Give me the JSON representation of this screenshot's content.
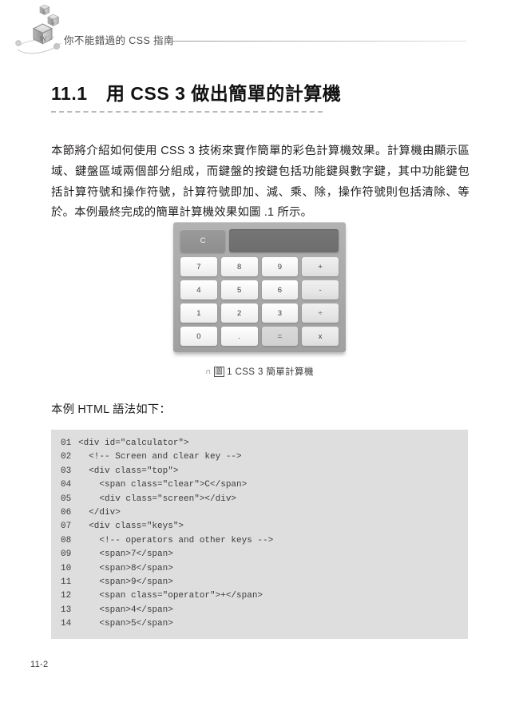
{
  "header": {
    "title": "你不能錯過的 CSS 指南",
    "logo_name": "cube-w-logo"
  },
  "section": {
    "number": "11.1",
    "heading": "11.1 用 CSS 3 做出簡單的計算機"
  },
  "paragraph": "本節將介紹如何使用 CSS 3 技術來實作簡單的彩色計算機效果。計算機由顯示區域、鍵盤區域兩個部分組成，而鍵盤的按鍵包括功能鍵與數字鍵，其中功能鍵包括計算符號和操作符號，計算符號即加、減、乘、除，操作符號則包括清除、等於。本例最終完成的簡單計算機效果如圖 .1 所示。",
  "figure": {
    "calculator": {
      "clear_label": "C",
      "screen_value": "",
      "keys": [
        {
          "label": "7",
          "type": "number"
        },
        {
          "label": "8",
          "type": "number"
        },
        {
          "label": "9",
          "type": "number"
        },
        {
          "label": "+",
          "type": "operator"
        },
        {
          "label": "4",
          "type": "number"
        },
        {
          "label": "5",
          "type": "number"
        },
        {
          "label": "6",
          "type": "number"
        },
        {
          "label": "-",
          "type": "operator"
        },
        {
          "label": "1",
          "type": "number"
        },
        {
          "label": "2",
          "type": "number"
        },
        {
          "label": "3",
          "type": "number"
        },
        {
          "label": "÷",
          "type": "operator"
        },
        {
          "label": "0",
          "type": "number"
        },
        {
          "label": ".",
          "type": "number"
        },
        {
          "label": "=",
          "type": "equals"
        },
        {
          "label": "x",
          "type": "operator"
        }
      ]
    },
    "caption_mark": "∩",
    "caption_box": "圖",
    "caption_text": "1  CSS 3 簡單計算機"
  },
  "lead_in": "本例 HTML 語法如下：",
  "code": {
    "lines": [
      {
        "no": "01",
        "src": "<div id=\"calculator\">"
      },
      {
        "no": "02",
        "src": "  <!-- Screen and clear key -->"
      },
      {
        "no": "03",
        "src": "  <div class=\"top\">"
      },
      {
        "no": "04",
        "src": "    <span class=\"clear\">C</span>"
      },
      {
        "no": "05",
        "src": "    <div class=\"screen\"></div>"
      },
      {
        "no": "06",
        "src": "  </div>"
      },
      {
        "no": "07",
        "src": "  <div class=\"keys\">"
      },
      {
        "no": "08",
        "src": "    <!-- operators and other keys -->"
      },
      {
        "no": "09",
        "src": "    <span>7</span>"
      },
      {
        "no": "10",
        "src": "    <span>8</span>"
      },
      {
        "no": "11",
        "src": "    <span>9</span>"
      },
      {
        "no": "12",
        "src": "    <span class=\"operator\">+</span>"
      },
      {
        "no": "13",
        "src": "    <span>4</span>"
      },
      {
        "no": "14",
        "src": "    <span>5</span>"
      }
    ]
  },
  "folio": "11-2"
}
